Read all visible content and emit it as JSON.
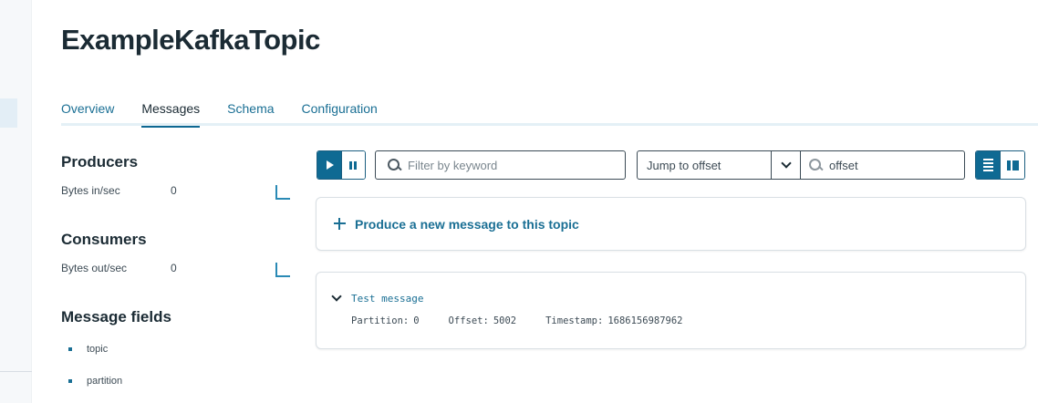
{
  "page": {
    "title": "ExampleKafkaTopic"
  },
  "tabs": [
    {
      "label": "Overview",
      "active": false
    },
    {
      "label": "Messages",
      "active": true
    },
    {
      "label": "Schema",
      "active": false
    },
    {
      "label": "Configuration",
      "active": false
    }
  ],
  "producers": {
    "heading": "Producers",
    "metric_label": "Bytes in/sec",
    "metric_value": "0"
  },
  "consumers": {
    "heading": "Consumers",
    "metric_label": "Bytes out/sec",
    "metric_value": "0"
  },
  "message_fields": {
    "heading": "Message fields",
    "items": [
      "topic",
      "partition"
    ]
  },
  "toolbar": {
    "filter_placeholder": "Filter by keyword",
    "jump_select_value": "Jump to offset",
    "offset_placeholder": "offset"
  },
  "produce": {
    "label": "Produce a new message to this topic"
  },
  "message": {
    "title": "Test message",
    "partition_label": "Partition:",
    "partition_value": "0",
    "offset_label": "Offset:",
    "offset_value": "5002",
    "timestamp_label": "Timestamp:",
    "timestamp_value": "1686156987962"
  },
  "colors": {
    "accent": "#0f6a93",
    "link": "#1a6f94",
    "text": "#1b2b34"
  },
  "icons": [
    "play-icon",
    "pause-icon",
    "search-icon",
    "chevron-down-icon",
    "list-view-icon",
    "split-view-icon",
    "plus-icon",
    "sparkline-icon"
  ]
}
